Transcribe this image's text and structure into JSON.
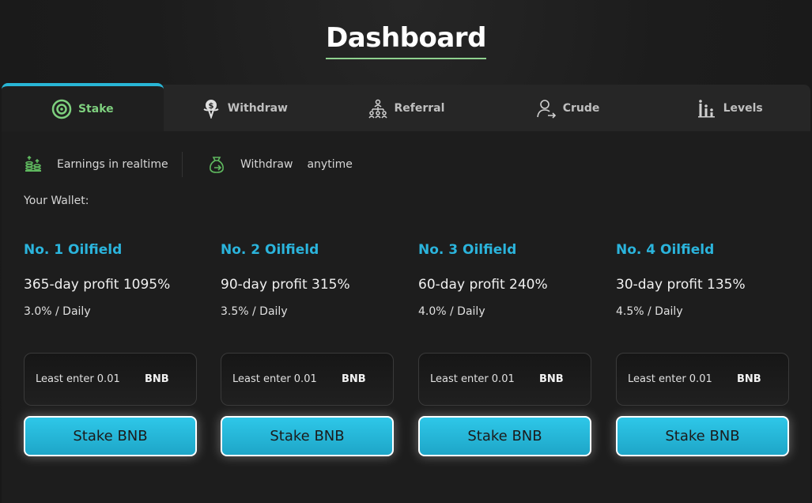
{
  "page_title": "Dashboard",
  "tabs": [
    {
      "label": "Stake",
      "icon": "stake-icon",
      "active": true
    },
    {
      "label": "Withdraw",
      "icon": "withdraw-icon",
      "active": false
    },
    {
      "label": "Referral",
      "icon": "referral-icon",
      "active": false
    },
    {
      "label": "Crude",
      "icon": "crude-icon",
      "active": false
    },
    {
      "label": "Levels",
      "icon": "levels-icon",
      "active": false
    }
  ],
  "features": {
    "earnings": "Earnings in realtime",
    "withdraw": "Withdraw",
    "anytime": "anytime"
  },
  "wallet_label": "Your Wallet:",
  "oilfields": [
    {
      "title": "No. 1 Oilfield",
      "profit": "365-day profit 1095%",
      "daily": "3.0% / Daily",
      "placeholder": "Least enter 0.01",
      "unit": "BNB",
      "button": "Stake BNB"
    },
    {
      "title": "No. 2 Oilfield",
      "profit": "90-day profit 315%",
      "daily": "3.5% / Daily",
      "placeholder": "Least enter 0.01",
      "unit": "BNB",
      "button": "Stake BNB"
    },
    {
      "title": "No. 3 Oilfield",
      "profit": "60-day profit 240%",
      "daily": "4.0% / Daily",
      "placeholder": "Least enter 0.01",
      "unit": "BNB",
      "button": "Stake BNB"
    },
    {
      "title": "No. 4 Oilfield",
      "profit": "30-day profit 135%",
      "daily": "4.5% / Daily",
      "placeholder": "Least enter 0.01",
      "unit": "BNB",
      "button": "Stake BNB"
    }
  ],
  "colors": {
    "accent_blue": "#2bb4dc",
    "accent_green": "#7ed07e",
    "background": "#1d1d1d"
  }
}
